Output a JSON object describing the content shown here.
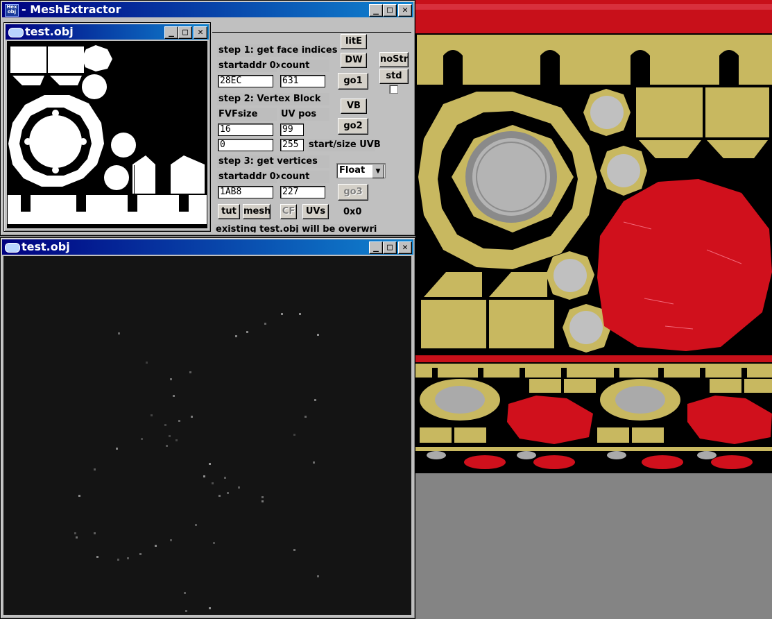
{
  "main_window": {
    "title": "MeshExtractor",
    "icon_text": "Hex obj"
  },
  "uv_window": {
    "title": "test.obj"
  },
  "mesh_window": {
    "title": "test.obj"
  },
  "window_buttons": {
    "minimize": "_",
    "maximize": "□",
    "close": "✕"
  },
  "panel": {
    "step1": "step 1: get face indices",
    "startaddr_label": "startaddr 0x",
    "count_label": "count",
    "face_startaddr": "28EC",
    "face_count": "631",
    "step2": "step 2: Vertex Block",
    "fvf_label": "FVFsize",
    "uvpos_label": "UV pos",
    "fvf_size": "16",
    "uv_pos": "99",
    "uvb_start": "0",
    "uvb_size": "255",
    "uvb_label": "start/size UVB",
    "step3": "step 3: get vertices",
    "vert_startaddr": "1AB8",
    "vert_count": "227",
    "format_selected": "Float",
    "hex_display": "0x0",
    "warning": "existing test.obj will be overwritten!)"
  },
  "buttons": {
    "lite": "litE",
    "dw": "DW",
    "go1": "go1",
    "nostr": "noStr",
    "std": "std",
    "vb": "VB",
    "go2": "go2",
    "go3": "go3",
    "tut": "tut",
    "mesh": "mesh",
    "cf": "CF",
    "uvs": "UVs"
  },
  "colors": {
    "title_start": "#000080",
    "title_end": "#1084d0",
    "texture_red": "#d0101c",
    "texture_gold": "#c8b860",
    "mesh_bg": "#141414"
  }
}
